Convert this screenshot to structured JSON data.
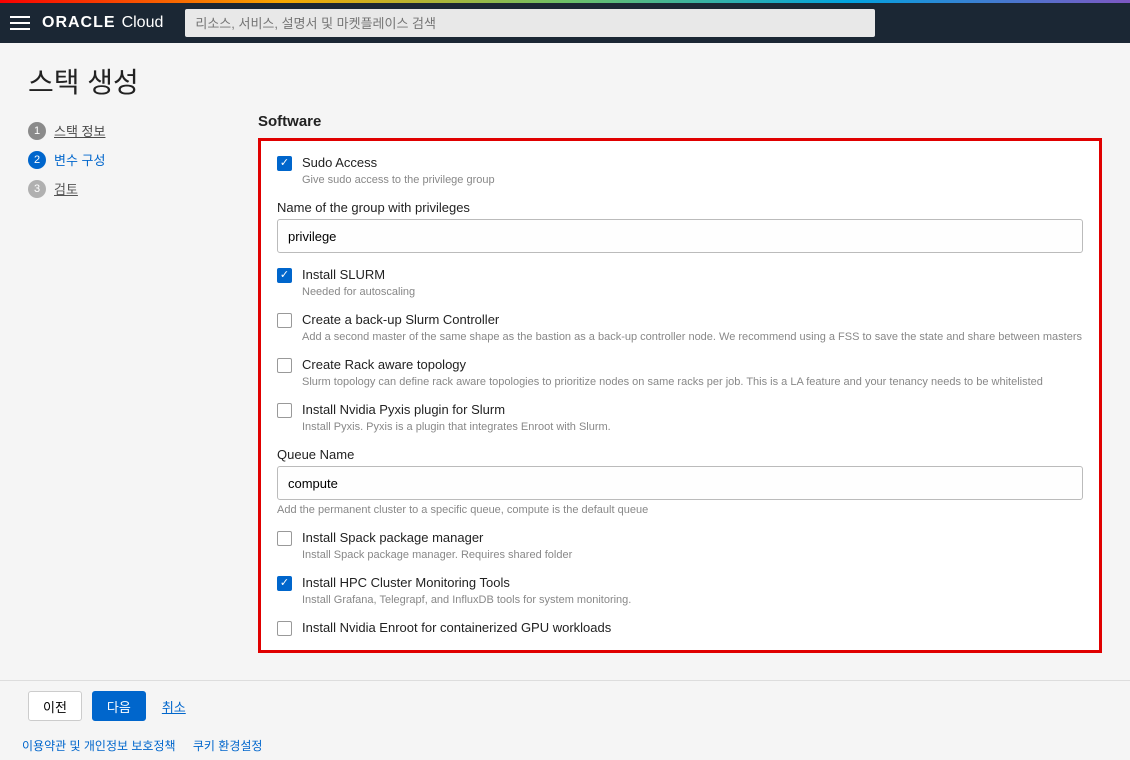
{
  "header": {
    "brand_oracle": "ORACLE",
    "brand_cloud": "Cloud",
    "search_placeholder": "리소스, 서비스, 설명서 및 마켓플레이스 검색"
  },
  "page": {
    "title": "스택 생성"
  },
  "stepper": {
    "steps": [
      {
        "num": "1",
        "label": "스택 정보",
        "state": "done"
      },
      {
        "num": "2",
        "label": "변수 구성",
        "state": "active"
      },
      {
        "num": "3",
        "label": "검토",
        "state": "pending"
      }
    ]
  },
  "section": {
    "title": "Software"
  },
  "fields": {
    "sudo": {
      "label": "Sudo Access",
      "help": "Give sudo access to the privilege group",
      "checked": true
    },
    "group_name": {
      "label": "Name of the group with privileges",
      "value": "privilege"
    },
    "slurm": {
      "label": "Install SLURM",
      "help": "Needed for autoscaling",
      "checked": true
    },
    "backup_controller": {
      "label": "Create a back-up Slurm Controller",
      "help": "Add a second master of the same shape as the bastion as a back-up controller node. We recommend using a FSS to save the state and share between masters",
      "checked": false
    },
    "rack_topology": {
      "label": "Create Rack aware topology",
      "help": "Slurm topology can define rack aware topologies to prioritize nodes on same racks per job. This is a LA feature and your tenancy needs to be whitelisted",
      "checked": false
    },
    "pyxis": {
      "label": "Install Nvidia Pyxis plugin for Slurm",
      "help": "Install Pyxis. Pyxis is a plugin that integrates Enroot with Slurm.",
      "checked": false
    },
    "queue": {
      "label": "Queue Name",
      "value": "compute",
      "help": "Add the permanent cluster to a specific queue, compute is the default queue"
    },
    "spack": {
      "label": "Install Spack package manager",
      "help": "Install Spack package manager. Requires shared folder",
      "checked": false
    },
    "monitoring": {
      "label": "Install HPC Cluster Monitoring Tools",
      "help": "Install Grafana, Telegrapf, and InfluxDB tools for system monitoring.",
      "checked": true
    },
    "enroot": {
      "label": "Install Nvidia Enroot for containerized GPU workloads",
      "checked": false
    }
  },
  "footer": {
    "prev": "이전",
    "next": "다음",
    "cancel": "취소",
    "terms": "이용약관 및 개인정보 보호정책",
    "cookies": "쿠키 환경설정"
  }
}
